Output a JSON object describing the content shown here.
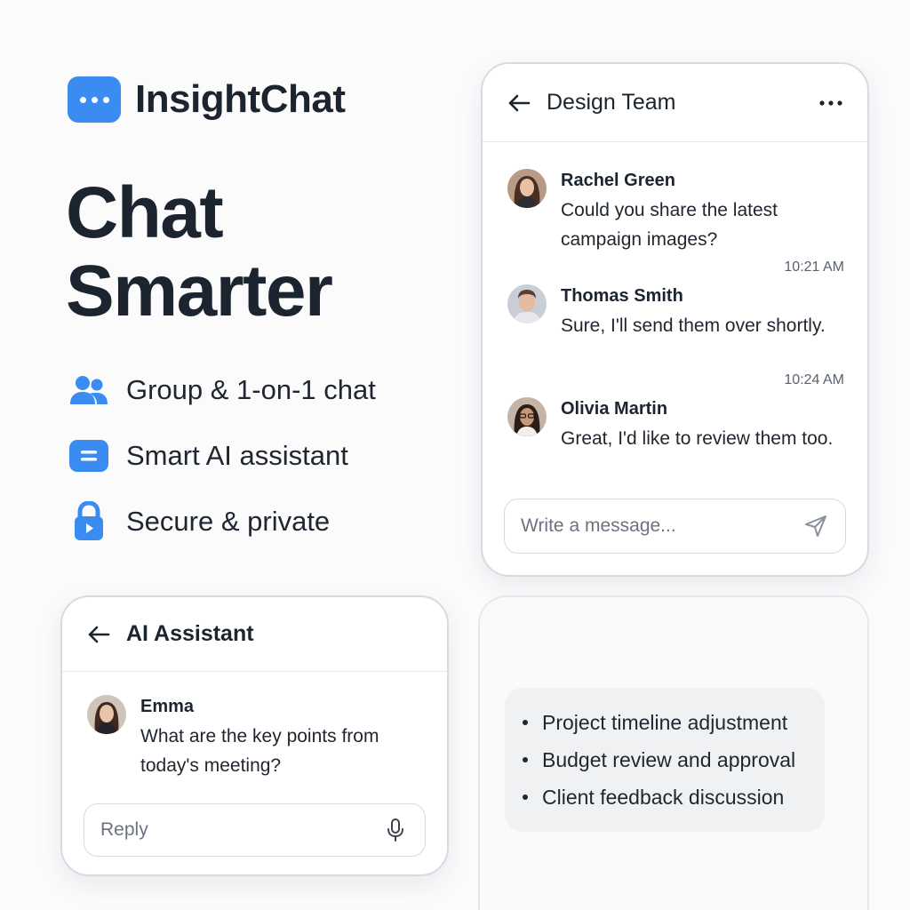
{
  "brand": {
    "name": "InsightChat",
    "icon": "chat-bubble-icon",
    "color": "#3b8cf0"
  },
  "hero": {
    "line1": "Chat",
    "line2": "Smarter"
  },
  "features": [
    {
      "icon": "users-icon",
      "label": "Group & 1-on-1 chat"
    },
    {
      "icon": "message-icon",
      "label": "Smart AI assistant"
    },
    {
      "icon": "lock-icon",
      "label": "Secure & private"
    }
  ],
  "team_chat": {
    "title": "Design Team",
    "messages": [
      {
        "name": "Rachel Green",
        "text": "Could you share the latest campaign images?",
        "time": ""
      },
      {
        "name": "Thomas Smith",
        "text": "Sure, I'll send them over shortly.",
        "time": "10:21 AM"
      },
      {
        "name": "Olivia Martin",
        "text": "Great, I'd like to review them too.",
        "time": "10:24 AM"
      }
    ],
    "composer_placeholder": "Write a message..."
  },
  "ai_chat": {
    "title": "AI Assistant",
    "message": {
      "name": "Emma",
      "text": "What are the key points from today's meeting?"
    },
    "reply_placeholder": "Reply"
  },
  "summary": {
    "items": [
      "Project timeline adjustment",
      "Budget review and approval",
      "Client feedback discussion"
    ]
  }
}
